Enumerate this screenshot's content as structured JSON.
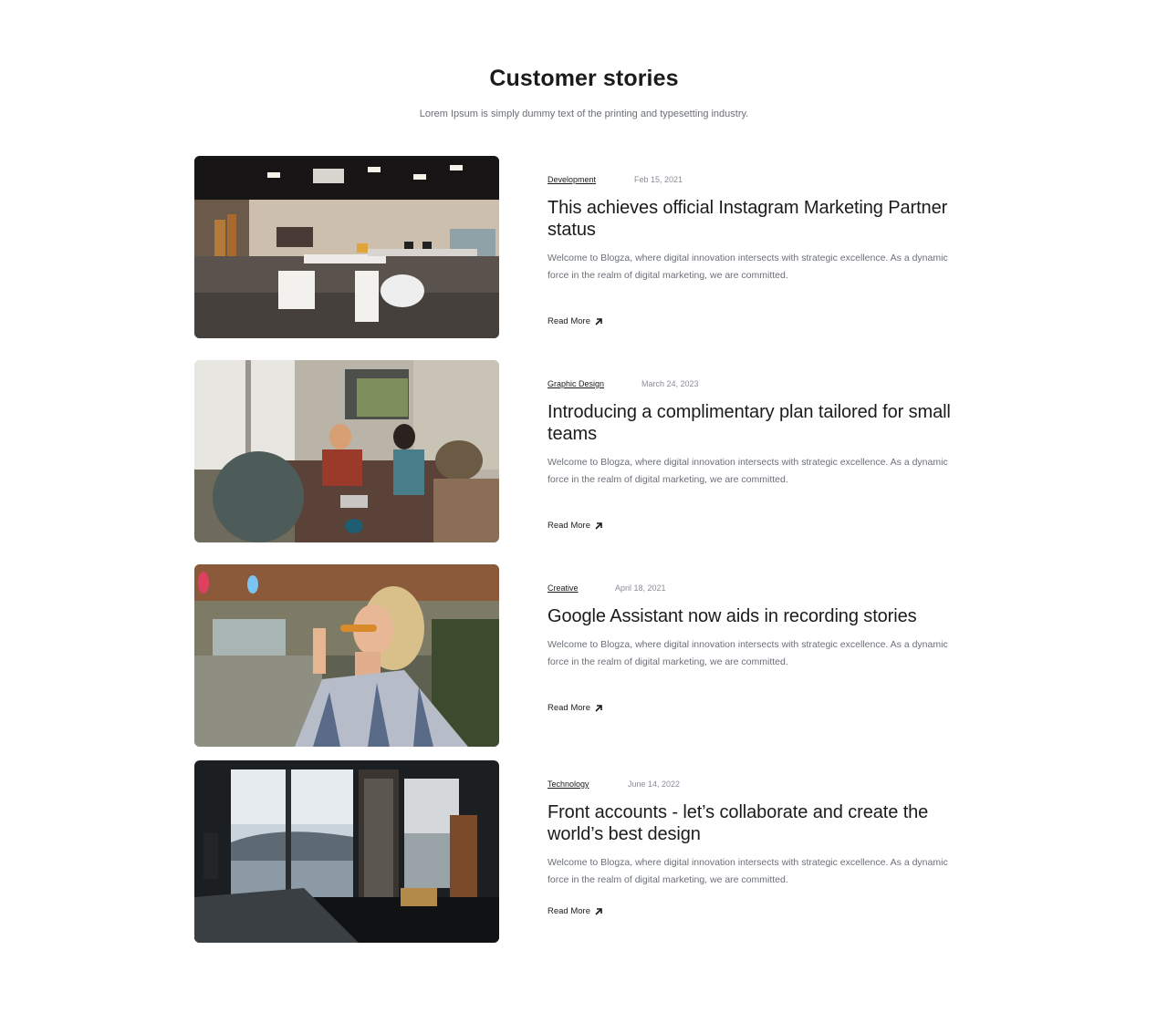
{
  "section": {
    "title": "Customer stories",
    "subtitle": "Lorem Ipsum is simply dummy text of the printing and typesetting industry."
  },
  "stories": [
    {
      "category": "Development",
      "date": "Feb 15, 2021",
      "title": "This achieves official Instagram Marketing Partner status",
      "excerpt": "Welcome to Blogza, where digital innovation intersects with strategic excellence. As a dynamic force in the realm of digital marketing, we are committed.",
      "read_more": "Read More",
      "image": "office-workspace-photo"
    },
    {
      "category": "Graphic Design",
      "date": "March 24, 2023",
      "title": "Introducing a complimentary plan tailored for small teams",
      "excerpt": "Welcome to Blogza, where digital innovation intersects with strategic excellence. As a dynamic force in the realm of digital marketing, we are committed.",
      "read_more": "Read More",
      "image": "team-meeting-photo"
    },
    {
      "category": "Creative",
      "date": "April 18, 2021",
      "title": "Google Assistant now aids in recording stories",
      "excerpt": "Welcome to Blogza, where digital innovation intersects with strategic excellence. As a dynamic force in the realm of digital marketing, we are committed.",
      "read_more": "Read More",
      "image": "woman-sunglasses-photo"
    },
    {
      "category": "Technology",
      "date": "June 14, 2022",
      "title": "Front accounts - let’s collaborate and create the world’s best design",
      "excerpt": "Welcome to Blogza, where digital innovation intersects with strategic excellence. As a dynamic force in the realm of digital marketing, we are committed.",
      "read_more": "Read More",
      "image": "window-desk-view-photo"
    }
  ],
  "icons": {
    "read_more": "arrow-up-right-icon"
  }
}
